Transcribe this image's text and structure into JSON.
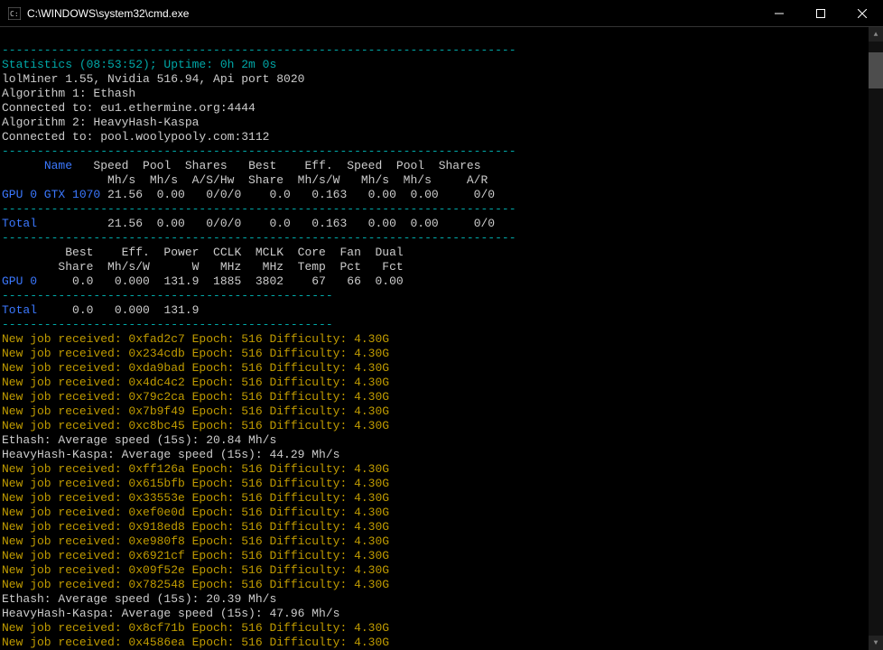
{
  "titlebar": {
    "title": "C:\\WINDOWS\\system32\\cmd.exe"
  },
  "sep": "-------------------------------------------------------------------------",
  "sep_short": "-----------------------------------------------",
  "stats_line": "Statistics (08:53:52); Uptime: 0h 2m 0s",
  "miner_line": "lolMiner 1.55, Nvidia 516.94, Api port 8020",
  "algo1": "Algorithm 1: Ethash",
  "conn1": "Connected to: eu1.ethermine.org:4444",
  "algo2": "Algorithm 2: HeavyHash-Kaspa",
  "conn2": "Connected to: pool.woolypooly.com:3112",
  "table1_hdr1_name": "Name",
  "table1_hdr1_rest": "   Speed  Pool  Shares   Best    Eff.  Speed  Pool  Shares",
  "table1_hdr2": "               Mh/s  Mh/s  A/S/Hw  Share  Mh/s/W   Mh/s  Mh/s     A/R",
  "gpu0_label": "GPU 0 GTX 1070",
  "gpu0_row": " 21.56  0.00   0/0/0    0.0   0.163   0.00  0.00     0/0",
  "total_label": "Total",
  "total_row1": "          21.56  0.00   0/0/0    0.0   0.163   0.00  0.00     0/0",
  "table2_hdr1": "         Best    Eff.  Power  CCLK  MCLK  Core  Fan  Dual",
  "table2_hdr2": "        Share  Mh/s/W      W   MHz   MHz  Temp  Pct   Fct",
  "gpu0_label2": "GPU 0",
  "gpu0_row2": "     0.0   0.000  131.9  1885  3802    67   66  0.00",
  "total_row2": "     0.0   0.000  131.9",
  "jobs": [
    "New job received: 0xfad2c7 Epoch: 516 Difficulty: 4.30G",
    "New job received: 0x234cdb Epoch: 516 Difficulty: 4.30G",
    "New job received: 0xda9bad Epoch: 516 Difficulty: 4.30G",
    "New job received: 0x4dc4c2 Epoch: 516 Difficulty: 4.30G",
    "New job received: 0x79c2ca Epoch: 516 Difficulty: 4.30G",
    "New job received: 0x7b9f49 Epoch: 516 Difficulty: 4.30G",
    "New job received: 0xc8bc45 Epoch: 516 Difficulty: 4.30G"
  ],
  "ethash_speed1": "Ethash: Average speed (15s): 20.84 Mh/s",
  "heavy_speed1": "HeavyHash-Kaspa: Average speed (15s): 44.29 Mh/s",
  "jobs2": [
    "New job received: 0xff126a Epoch: 516 Difficulty: 4.30G",
    "New job received: 0x615bfb Epoch: 516 Difficulty: 4.30G",
    "New job received: 0x33553e Epoch: 516 Difficulty: 4.30G",
    "New job received: 0xef0e0d Epoch: 516 Difficulty: 4.30G",
    "New job received: 0x918ed8 Epoch: 516 Difficulty: 4.30G",
    "New job received: 0xe980f8 Epoch: 516 Difficulty: 4.30G",
    "New job received: 0x6921cf Epoch: 516 Difficulty: 4.30G",
    "New job received: 0x09f52e Epoch: 516 Difficulty: 4.30G",
    "New job received: 0x782548 Epoch: 516 Difficulty: 4.30G"
  ],
  "ethash_speed2": "Ethash: Average speed (15s): 20.39 Mh/s",
  "heavy_speed2": "HeavyHash-Kaspa: Average speed (15s): 47.96 Mh/s",
  "jobs3": [
    "New job received: 0x8cf71b Epoch: 516 Difficulty: 4.30G",
    "New job received: 0x4586ea Epoch: 516 Difficulty: 4.30G"
  ]
}
